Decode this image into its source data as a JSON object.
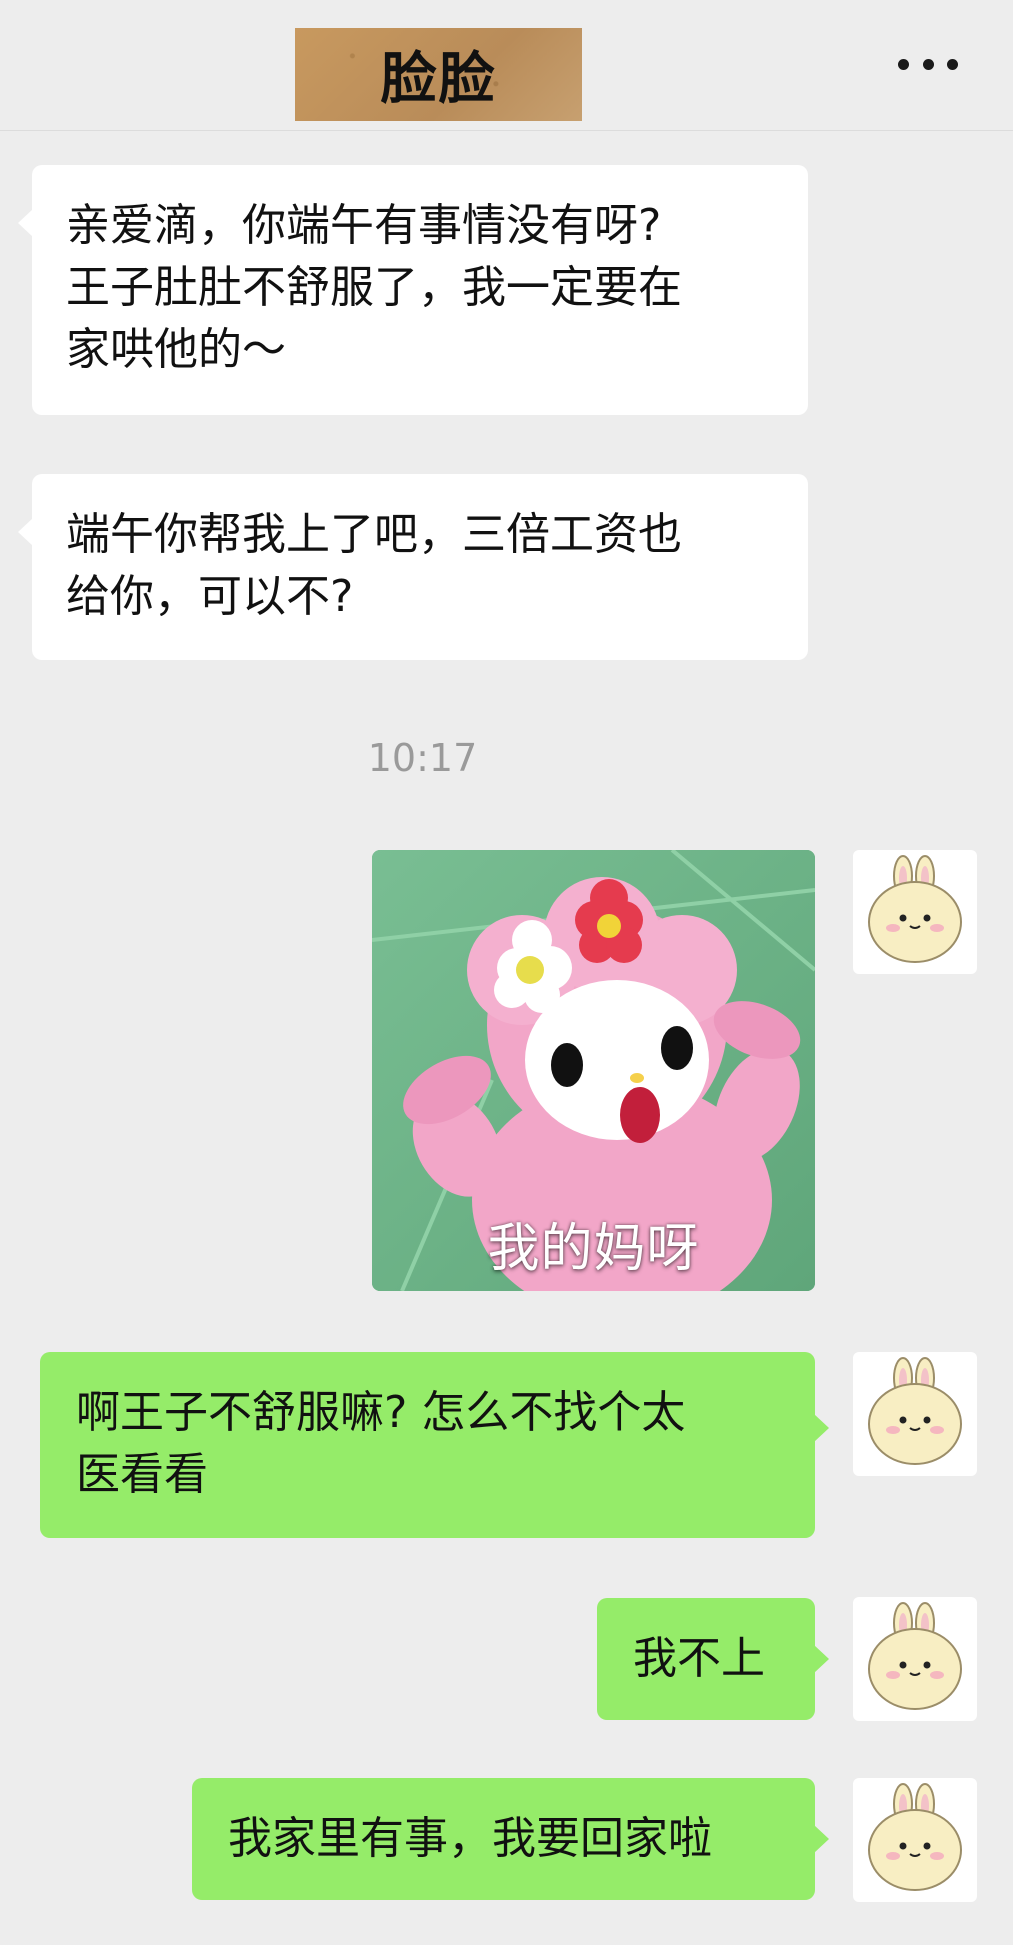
{
  "header": {
    "title": "脸脸",
    "more_icon": "more-dots-icon"
  },
  "messages": [
    {
      "side": "left",
      "text_lines": [
        "亲爱滴，你端午有事情没有呀?",
        "王子肚肚不舒服了，我一定要在",
        "家哄他的～"
      ]
    },
    {
      "side": "left",
      "text_lines": [
        "端午你帮我上了吧，三倍工资也",
        "给你，可以不?"
      ]
    },
    {
      "timestamp": "10:17"
    },
    {
      "side": "right",
      "sticker_caption": "我的妈呀"
    },
    {
      "side": "right",
      "text_lines": [
        "啊王子不舒服嘛? 怎么不找个太",
        "医看看"
      ]
    },
    {
      "side": "right",
      "text_lines": [
        "我不上"
      ]
    },
    {
      "side": "right",
      "text_lines": [
        "我家里有事，我要回家啦"
      ]
    }
  ],
  "colors": {
    "background": "#ededed",
    "incoming_bubble": "#ffffff",
    "outgoing_bubble": "#95ec69",
    "timestamp_text": "#9a9a9a"
  },
  "avatar_icon": "bunny-avatar-icon"
}
